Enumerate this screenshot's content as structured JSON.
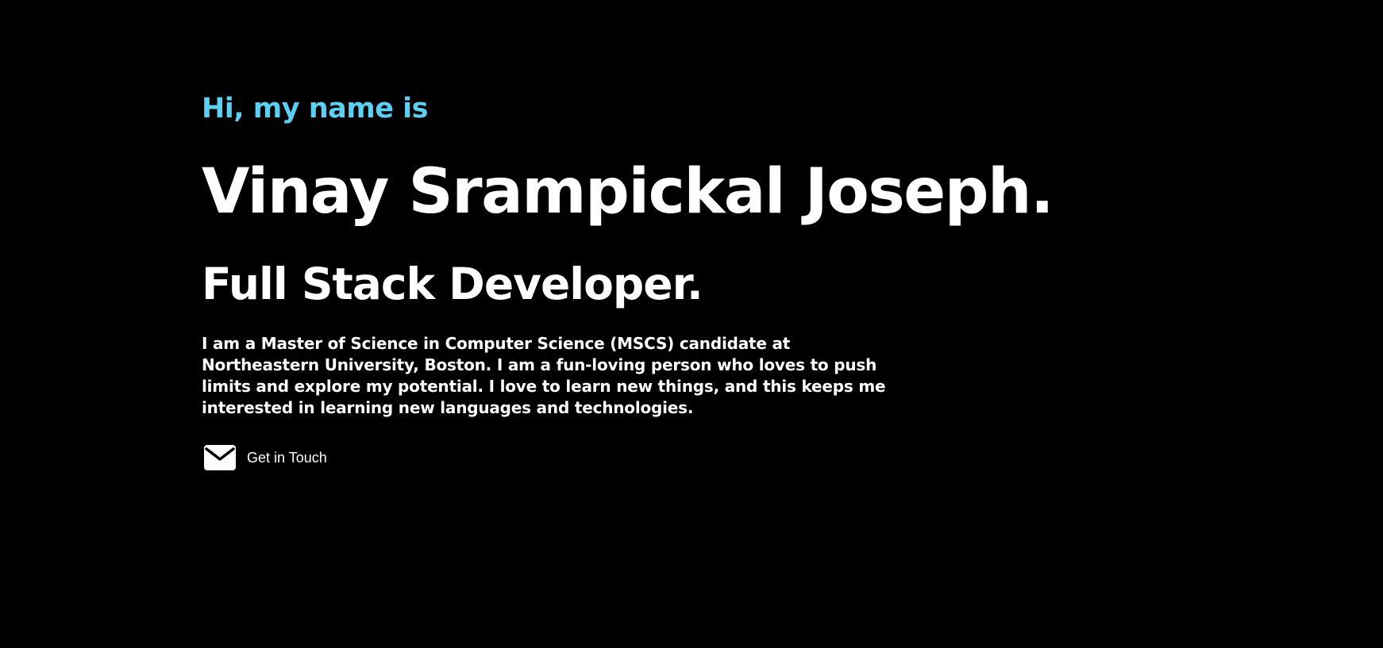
{
  "hero": {
    "intro": "Hi, my name is",
    "name": "Vinay Srampickal Joseph.",
    "role": "Full Stack Developer.",
    "bio": "I am a Master of Science in Computer Science (MSCS) candidate at Northeastern University, Boston. I am a fun-loving person who loves to push limits and explore my potential. I love to learn new things, and this keeps me interested in learning new languages and technologies.",
    "contact": {
      "label": "Get in Touch",
      "icon": "mail-icon"
    }
  },
  "colors": {
    "background": "#000000",
    "accent": "#5ccff2",
    "text": "#ffffff"
  }
}
